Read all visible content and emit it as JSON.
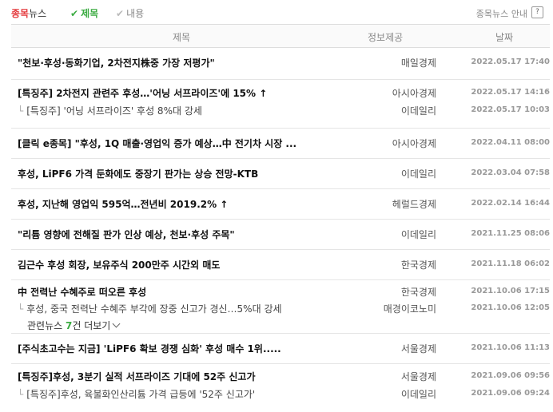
{
  "header": {
    "title_red": "종목",
    "title_rest": "뉴스",
    "option_title_label": "제목",
    "option_content_label": "내용",
    "guide_label": "종목뉴스 안내",
    "guide_icon": "?"
  },
  "table_header": {
    "title": "제목",
    "source": "정보제공",
    "date": "날짜"
  },
  "news": [
    {
      "title": "\"천보·후성·동화기업, 2차전지株중 가장 저평가\"",
      "source": "매일경제",
      "date": "2022.05.17 17:40"
    },
    {
      "title": "[특징주] 2차전지 관련주 후성…'어닝 서프라이즈'에 15% ↑",
      "source": "아시아경제",
      "date": "2022.05.17 14:16"
    },
    {
      "title": "[특징주] '어닝 서프라이즈' 후성 8%대 강세",
      "source": "이데일리",
      "date": "2022.05.17 10:03"
    },
    {
      "title": "[클릭 e종목] \"후성, 1Q 매출·영업익 증가 예상…中 전기차 시장 ...",
      "source": "아시아경제",
      "date": "2022.04.11 08:00"
    },
    {
      "title": "후성, LiPF6 가격 둔화에도 중장기 판가는 상승 전망-KTB",
      "source": "이데일리",
      "date": "2022.03.04 07:58"
    },
    {
      "title": "후성, 지난해 영업익 595억…전년비 2019.2% ↑",
      "source": "헤럴드경제",
      "date": "2022.02.14 16:44"
    },
    {
      "title": "\"리튬 영향에 전해질 판가 인상 예상, 천보·후성 주목\"",
      "source": "이데일리",
      "date": "2021.11.25 08:06"
    },
    {
      "title": "김근수 후성 회장, 보유주식 200만주 시간외 매도",
      "source": "한국경제",
      "date": "2021.11.18 06:02"
    },
    {
      "title": "中 전력난 수혜주로 떠오른 후성",
      "source": "한국경제",
      "date": "2021.10.06 17:15"
    },
    {
      "title": "후성, 중국 전력난 수혜주 부각에 장중 신고가 경신…5%대 강세",
      "source": "매경이코노미",
      "date": "2021.10.06 12:05"
    },
    {
      "title": "[주식초고수는 지금] 'LiPF6 확보 경쟁 심화' 후성 매수 1위.....",
      "source": "서울경제",
      "date": "2021.10.06 11:13"
    },
    {
      "title": "[특징주]후성, 3분기 실적 서프라이즈 기대에 52주 신고가",
      "source": "서울경제",
      "date": "2021.09.06 09:56"
    },
    {
      "title": "[특징주]후성, 육불화인산리튬 가격 급등에 '52주 신고가'",
      "source": "이데일리",
      "date": "2021.09.06 09:24"
    }
  ],
  "related": {
    "prefix": "관련뉴스",
    "count": "7",
    "suffix": "건 더보기"
  }
}
